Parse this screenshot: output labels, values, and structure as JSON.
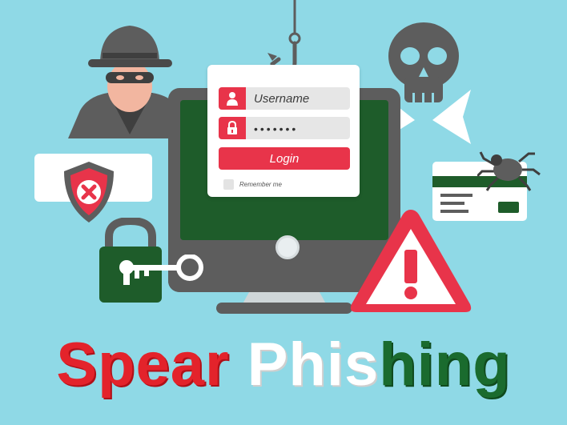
{
  "login": {
    "username_placeholder": "Username",
    "password_mask": "•••••••",
    "login_label": "Login",
    "remember_label": "Remember me"
  },
  "title": {
    "word1": "Spear",
    "word2_white": "Phis",
    "word2_green": "hing"
  },
  "icons": {
    "hacker": "hacker-icon",
    "hook": "fishing-hook-icon",
    "skull": "skull-crossbones-icon",
    "shield": "shield-x-icon",
    "padlock": "padlock-icon",
    "key": "key-icon",
    "warning": "warning-triangle-icon",
    "bug": "bug-icon",
    "credit_card": "credit-card-icon"
  },
  "colors": {
    "background": "#8fd9e6",
    "accent_red": "#e8344a",
    "dark_green": "#1e5c2a",
    "gray": "#5d5d5d"
  }
}
